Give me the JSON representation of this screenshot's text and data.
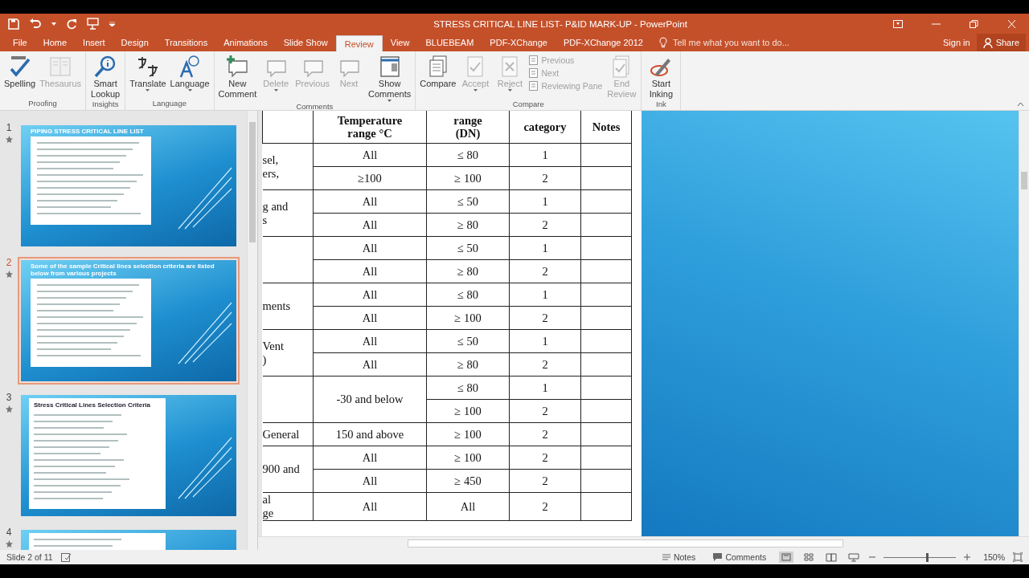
{
  "window": {
    "title": "STRESS CRITICAL LINE LIST- P&ID MARK-UP - PowerPoint"
  },
  "tabs": [
    {
      "label": "File",
      "selected": false
    },
    {
      "label": "Home",
      "selected": false
    },
    {
      "label": "Insert",
      "selected": false
    },
    {
      "label": "Design",
      "selected": false
    },
    {
      "label": "Transitions",
      "selected": false
    },
    {
      "label": "Animations",
      "selected": false
    },
    {
      "label": "Slide Show",
      "selected": false
    },
    {
      "label": "Review",
      "selected": true
    },
    {
      "label": "View",
      "selected": false
    },
    {
      "label": "BLUEBEAM",
      "selected": false
    },
    {
      "label": "PDF-XChange",
      "selected": false
    },
    {
      "label": "PDF-XChange 2012",
      "selected": false
    }
  ],
  "tell_me": {
    "placeholder": "Tell me what you want to do..."
  },
  "sign_in": "Sign in",
  "share": "Share",
  "ribbon": [
    {
      "label": "Proofing",
      "items": [
        {
          "label": "Spelling",
          "kind": "large",
          "disabled": false,
          "dropdown": false
        },
        {
          "label": "Thesaurus",
          "kind": "large",
          "disabled": true,
          "dropdown": false
        }
      ]
    },
    {
      "label": "Insights",
      "items": [
        {
          "label": "Smart\nLookup",
          "kind": "large",
          "disabled": false,
          "dropdown": false
        }
      ]
    },
    {
      "label": "Language",
      "items": [
        {
          "label": "Translate",
          "kind": "large",
          "disabled": false,
          "dropdown": true
        },
        {
          "label": "Language",
          "kind": "large",
          "disabled": false,
          "dropdown": true
        }
      ]
    },
    {
      "label": "Comments",
      "items": [
        {
          "label": "New\nComment",
          "kind": "large",
          "disabled": false,
          "dropdown": false
        },
        {
          "label": "Delete",
          "kind": "large",
          "disabled": true,
          "dropdown": true
        },
        {
          "label": "Previous",
          "kind": "large",
          "disabled": true,
          "dropdown": false
        },
        {
          "label": "Next",
          "kind": "large",
          "disabled": true,
          "dropdown": false
        },
        {
          "label": "Show\nComments",
          "kind": "large",
          "disabled": false,
          "dropdown": true
        }
      ]
    },
    {
      "label": "Compare",
      "items": [
        {
          "label": "Compare",
          "kind": "large",
          "disabled": false,
          "dropdown": false
        },
        {
          "label": "Accept",
          "kind": "large",
          "disabled": true,
          "dropdown": true
        },
        {
          "label": "Reject",
          "kind": "large",
          "disabled": true,
          "dropdown": true
        },
        {
          "label": "Previous",
          "kind": "small",
          "disabled": true
        },
        {
          "label": "Next",
          "kind": "small",
          "disabled": true
        },
        {
          "label": "Reviewing Pane",
          "kind": "small",
          "disabled": true
        },
        {
          "label": "End\nReview",
          "kind": "large",
          "disabled": true,
          "dropdown": false
        }
      ]
    },
    {
      "label": "Ink",
      "items": [
        {
          "label": "Start\nInking",
          "kind": "large",
          "disabled": false,
          "dropdown": false
        }
      ]
    }
  ],
  "slides": [
    {
      "number": "1",
      "title": "PIPING STRESS CRITICAL LINE LIST",
      "kind": "title-over",
      "selected": false
    },
    {
      "number": "2",
      "title": "Some of the sample Critical lines selection criteria are listed below from various projects",
      "kind": "title-over",
      "selected": true
    },
    {
      "number": "3",
      "title": "Stress Critical Lines Selection Criteria",
      "kind": "boxed",
      "selected": false
    },
    {
      "number": "4",
      "kind": "boxed",
      "selected": false
    }
  ],
  "table": {
    "columns": [
      {},
      {
        "lines": "Temperature\nrange °C"
      },
      {
        "lines": "range\n(DN)"
      },
      {
        "lines": "category"
      },
      {
        "lines": "Notes"
      }
    ],
    "groups": [
      {
        "description": "sel,\ners,",
        "rows": [
          {
            "temperature": "All",
            "size": "≤ 80",
            "category": "1"
          },
          {
            "temperature": "≥100",
            "size": "≥ 100",
            "category": "2"
          }
        ]
      },
      {
        "description": "g and\ns",
        "rows": [
          {
            "temperature": "All",
            "size": "≤ 50",
            "category": "1"
          },
          {
            "temperature": "All",
            "size": "≥ 80",
            "category": "2"
          }
        ]
      },
      {
        "rows": [
          {
            "temperature": "All",
            "size": "≤ 50",
            "category": "1"
          },
          {
            "temperature": "All",
            "size": "≥ 80",
            "category": "2"
          }
        ]
      },
      {
        "description": "ments",
        "rows": [
          {
            "temperature": "All",
            "size": "≤ 80",
            "category": "1"
          },
          {
            "temperature": "All",
            "size": "≥ 100",
            "category": "2"
          }
        ]
      },
      {
        "description": "Vent\n)",
        "rows": [
          {
            "temperature": "All",
            "size": "≤ 50",
            "category": "1"
          },
          {
            "temperature": "All",
            "size": "≥ 80",
            "category": "2"
          }
        ]
      },
      {
        "temperature": "-30 and below",
        "rows": [
          {
            "size": "≤ 80",
            "category": "1"
          },
          {
            "size": "≥ 100",
            "category": "2"
          }
        ]
      },
      {
        "description": "General",
        "rows": [
          {
            "temperature": "150 and above",
            "size": "≥ 100",
            "category": "2"
          }
        ]
      },
      {
        "description": "900 and",
        "rows": [
          {
            "temperature": "All",
            "size": "≥ 100",
            "category": "2"
          },
          {
            "temperature": "All",
            "size": "≥ 450",
            "category": "2"
          }
        ]
      },
      {
        "description": "al\nge",
        "rows": [
          {
            "temperature": "All",
            "size": "All",
            "category": "2"
          }
        ]
      }
    ]
  },
  "status_bar": {
    "slide": "Slide 2 of 11",
    "notes": "Notes",
    "comments": "Comments",
    "zoom": "150%",
    "zoom_level": {
      "level": 0.6
    }
  }
}
